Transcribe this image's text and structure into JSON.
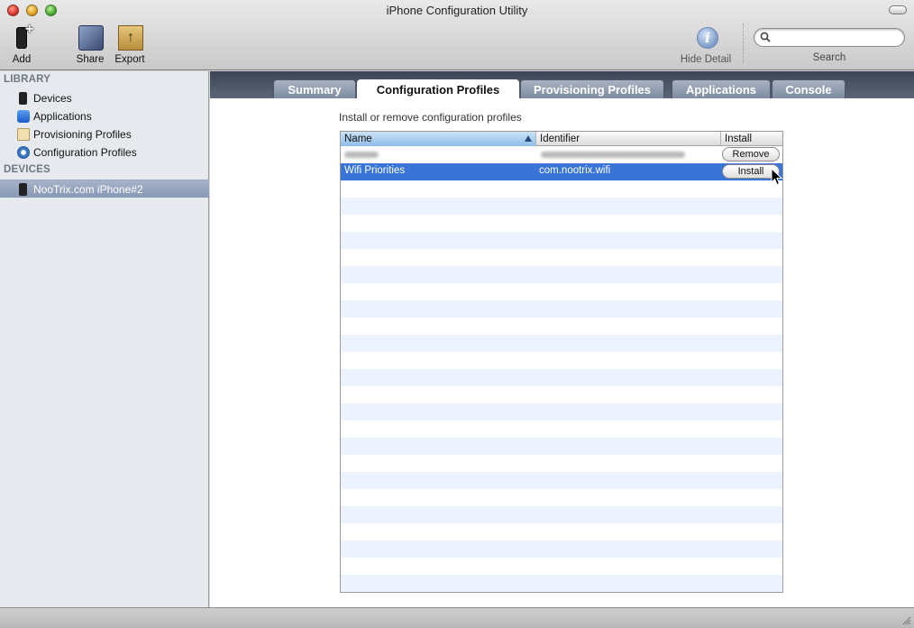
{
  "window": {
    "title": "iPhone Configuration Utility"
  },
  "toolbar": {
    "add_label": "Add",
    "share_label": "Share",
    "export_label": "Export",
    "hide_detail_label": "Hide Detail",
    "search_label": "Search",
    "search_value": ""
  },
  "sidebar": {
    "library_header": "LIBRARY",
    "library_items": [
      {
        "label": "Devices",
        "icon": "device-icon"
      },
      {
        "label": "Applications",
        "icon": "applications-icon"
      },
      {
        "label": "Provisioning Profiles",
        "icon": "provisioning-profile-icon"
      },
      {
        "label": "Configuration Profiles",
        "icon": "configuration-profile-icon"
      }
    ],
    "devices_header": "DEVICES",
    "device_items": [
      {
        "label": "NooTrix.com iPhone#2",
        "icon": "iphone-icon",
        "selected": true
      }
    ]
  },
  "tabs": [
    {
      "label": "Summary",
      "active": false
    },
    {
      "label": "Configuration Profiles",
      "active": true
    },
    {
      "label": "Provisioning Profiles",
      "active": false
    },
    {
      "label": "Applications",
      "active": false
    },
    {
      "label": "Console",
      "active": false
    }
  ],
  "content": {
    "instruction": "Install or remove configuration profiles",
    "columns": [
      "Name",
      "Identifier",
      "Install"
    ],
    "sorted_column": "Name",
    "rows": [
      {
        "name": "",
        "identifier": "",
        "action": "Remove",
        "redacted": true,
        "selected": false
      },
      {
        "name": "Wifi Priorities",
        "identifier": "com.nootrix.wifi",
        "action": "Install",
        "redacted": false,
        "selected": true
      }
    ]
  },
  "colors": {
    "selection_blue": "#3875d7",
    "tabbar_dark": "#3d4554",
    "sidebar_bg": "#e6eaef",
    "row_stripe": "#edf3fe"
  }
}
